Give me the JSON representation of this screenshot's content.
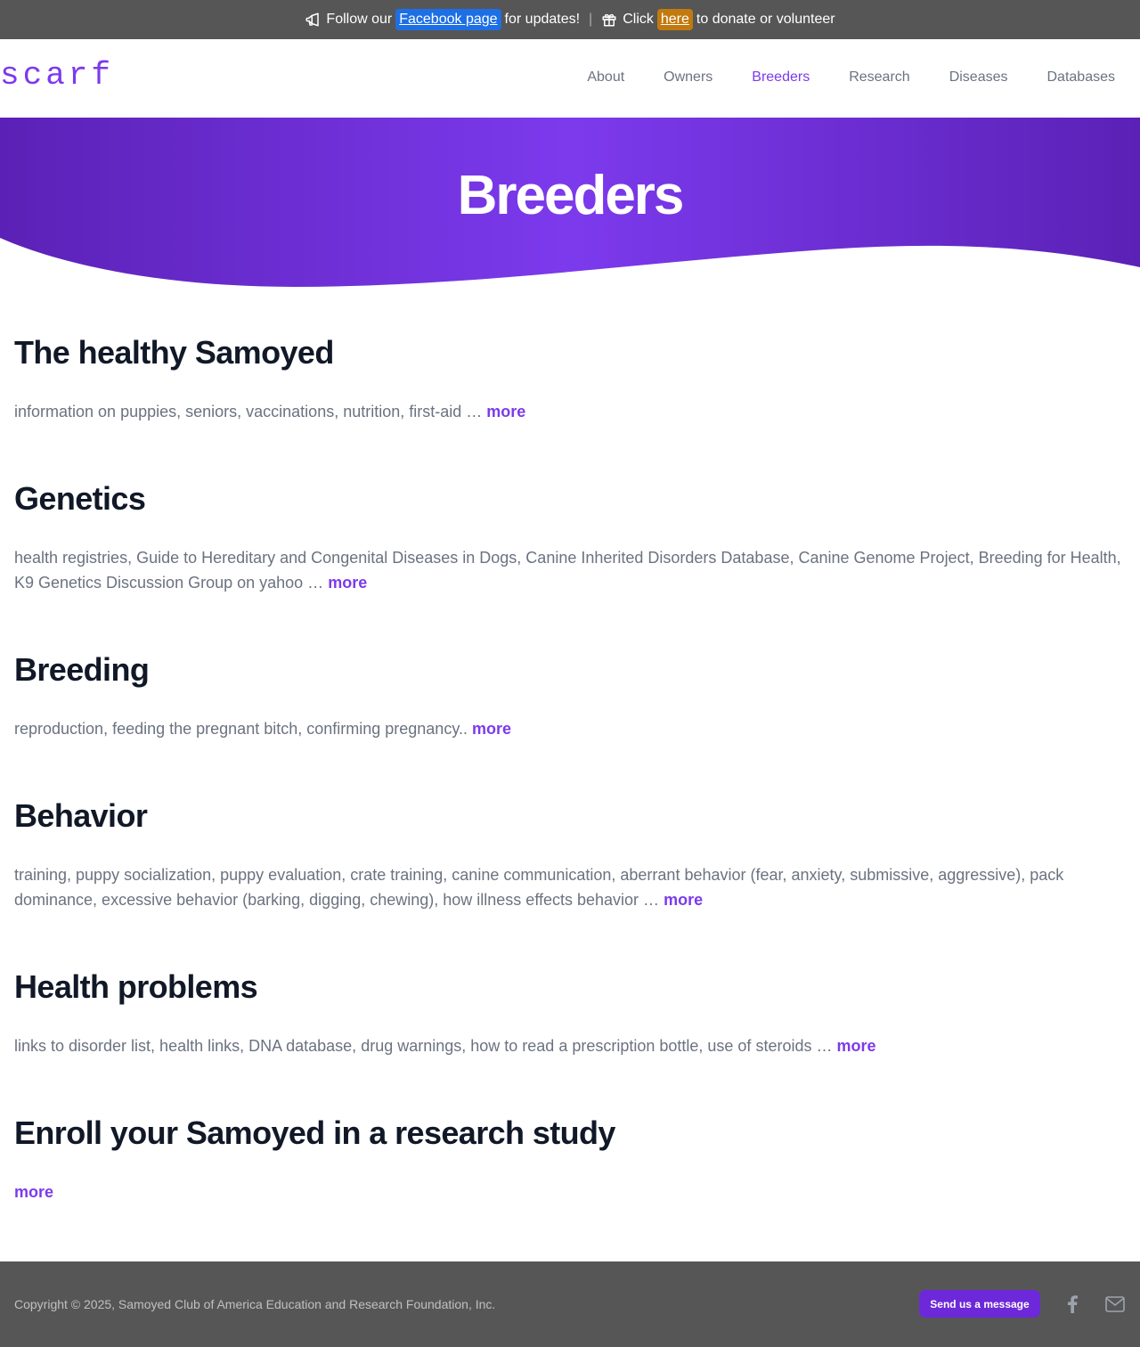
{
  "announcement": {
    "follow_prefix": "Follow our",
    "facebook_link": "Facebook page",
    "follow_suffix": "for updates!",
    "separator": "|",
    "click_prefix": "Click",
    "here_link": "here",
    "click_suffix": "to donate or volunteer"
  },
  "header": {
    "logo": "scarf",
    "nav": [
      {
        "label": "About"
      },
      {
        "label": "Owners"
      },
      {
        "label": "Breeders"
      },
      {
        "label": "Research"
      },
      {
        "label": "Diseases"
      },
      {
        "label": "Databases"
      }
    ]
  },
  "hero": {
    "title": "Breeders"
  },
  "sections": [
    {
      "title": "The healthy Samoyed",
      "text": "information on puppies, seniors, vaccinations, nutrition, first-aid … ",
      "more": "more"
    },
    {
      "title": "Genetics",
      "text": "health registries, Guide to Hereditary and Congenital Diseases in Dogs, Canine Inherited Disorders Database, Canine Genome Project, Breeding for Health, K9 Genetics Discussion Group on yahoo … ",
      "more": "more"
    },
    {
      "title": "Breeding",
      "text": "reproduction, feeding the pregnant bitch, confirming pregnancy.. ",
      "more": "more"
    },
    {
      "title": "Behavior",
      "text": "training, puppy socialization, puppy evaluation, crate training, canine communication, aberrant behavior (fear, anxiety, submissive, aggressive), pack dominance, excessive behavior (barking, digging, chewing), how illness effects behavior … ",
      "more": "more"
    },
    {
      "title": "Health problems",
      "text": "links to disorder list, health links, DNA database, drug warnings, how to read a prescription bottle, use of steroids … ",
      "more": "more"
    },
    {
      "title": "Enroll your Samoyed in a research study",
      "text": "",
      "more": "more"
    }
  ],
  "footer": {
    "copyright": "Copyright © 2025, Samoyed Club of America Education and Research Foundation, Inc.",
    "message_button": "Send us a message"
  },
  "colors": {
    "accent": "#7c3aed",
    "topbar_bg": "#565656",
    "facebook_pill": "#1d6fe5",
    "here_pill": "#c27a0e",
    "hero_dark": "#5b21b6",
    "hero_light": "#7c3aed"
  }
}
